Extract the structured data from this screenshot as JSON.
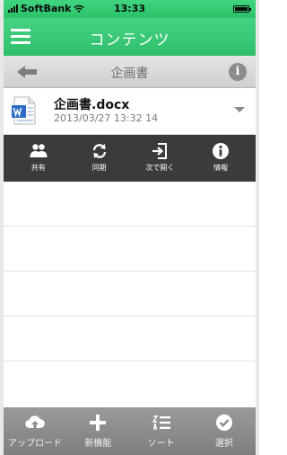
{
  "status_bar": {
    "carrier": "SoftBank",
    "time": "13:33"
  },
  "navbar": {
    "title": "コンテンツ"
  },
  "subheader": {
    "title": "企画書"
  },
  "file": {
    "name": "企画書.docx",
    "date": "2013/03/27 13:32 14",
    "icon": "word-doc-icon"
  },
  "actions": [
    {
      "label": "共有",
      "icon": "share-users-icon"
    },
    {
      "label": "同期",
      "icon": "sync-icon"
    },
    {
      "label": "次で開く",
      "icon": "open-in-icon"
    },
    {
      "label": "情報",
      "icon": "info-icon"
    }
  ],
  "tabs": [
    {
      "label": "アップロード",
      "icon": "cloud-upload-icon"
    },
    {
      "label": "新機能",
      "icon": "plus-icon"
    },
    {
      "label": "ソート",
      "icon": "sort-icon"
    },
    {
      "label": "選択",
      "icon": "checkmark-icon"
    }
  ],
  "colors": {
    "accent": "#2fbf6b",
    "action_bar": "#3b3b3b",
    "tab_bar": "#8c8c8c"
  }
}
